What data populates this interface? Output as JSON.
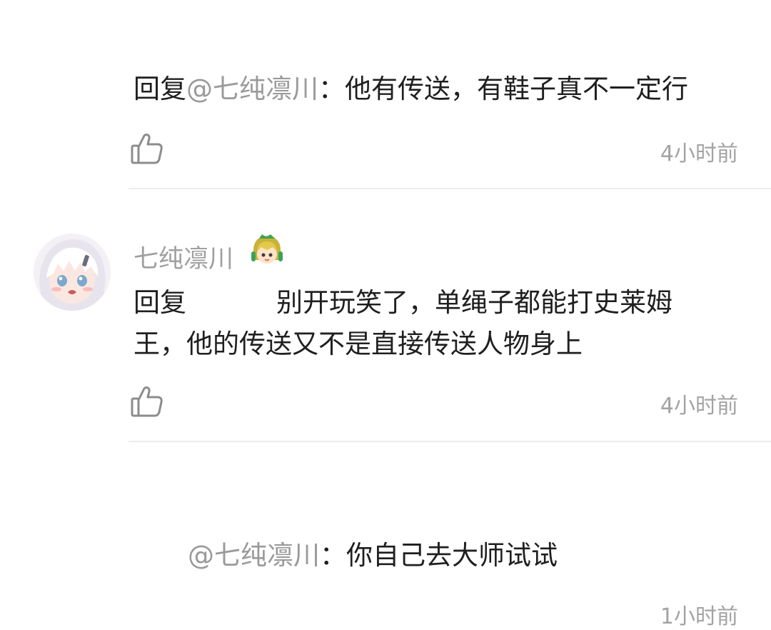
{
  "comments": [
    {
      "reply_prefix": "回复",
      "mention": "@七纯凛川",
      "text": "：他有传送，有鞋子真不一定行",
      "timestamp": "4小时前",
      "like_icon": "thumbs-up-icon"
    },
    {
      "username": "七纯凛川",
      "avatar_icon": "anime-girl-avatar",
      "badge_icon": "green-hair-character-badge",
      "reply_prefix": "回复",
      "line1": "别开玩笑了，单绳子都能打史莱姆",
      "line2": "王，他的传送又不是直接传送人物身上",
      "timestamp": "4小时前",
      "like_icon": "thumbs-up-icon"
    },
    {
      "mention": "@七纯凛川",
      "text": "：你自己去大师试试",
      "timestamp": "1小时前"
    }
  ],
  "colors": {
    "text": "#1f1f1f",
    "mention": "#9a9a9a",
    "username": "#a0a0a0",
    "timestamp": "#a3a3a3",
    "divider": "#ececec"
  }
}
